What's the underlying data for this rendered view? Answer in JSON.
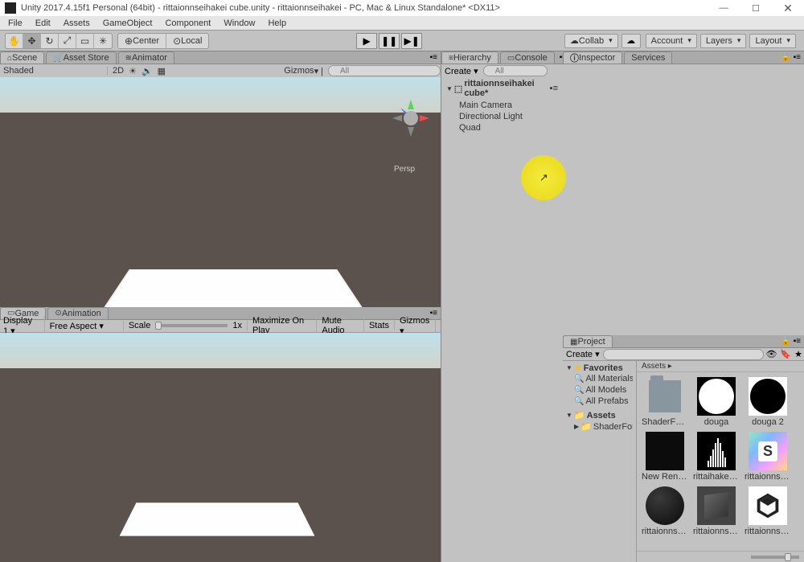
{
  "titlebar": {
    "text": "Unity 2017.4.15f1 Personal (64bit) - rittaionnseihakei cube.unity - rittaionnseihakei - PC, Mac & Linux Standalone* <DX11>",
    "minimize": "—",
    "maximize": "☐",
    "close": "✕"
  },
  "menubar": {
    "items": [
      "File",
      "Edit",
      "Assets",
      "GameObject",
      "Component",
      "Window",
      "Help"
    ]
  },
  "toolbar": {
    "center": "Center",
    "local": "Local",
    "collab": "Collab",
    "account": "Account",
    "layers": "Layers",
    "layout": "Layout"
  },
  "scene_tabs": {
    "scene": "Scene",
    "asset_store": "Asset Store",
    "animator": "Animator"
  },
  "scene_toolbar": {
    "shaded": "Shaded",
    "mode2d": "2D",
    "gizmos": "Gizmos",
    "search_placeholder": "All"
  },
  "scene_overlay": {
    "persp": "Persp"
  },
  "game_tabs": {
    "game": "Game",
    "animation": "Animation"
  },
  "game_toolbar": {
    "display": "Display 1",
    "aspect": "Free Aspect",
    "scale": "Scale",
    "scale_val": "1x",
    "max_play": "Maximize On Play",
    "mute": "Mute Audio",
    "stats": "Stats",
    "gizmos": "Gizmos"
  },
  "hierarchy": {
    "tab": "Hierarchy",
    "console": "Console",
    "create": "Create",
    "search_placeholder": "All",
    "scene": "rittaionnseihakei cube*",
    "items": [
      "Main Camera",
      "Directional Light",
      "Quad"
    ]
  },
  "inspector": {
    "inspector": "Inspector",
    "services": "Services"
  },
  "project": {
    "tab": "Project",
    "create": "Create",
    "favorites": "Favorites",
    "fav_items": [
      "All Materials",
      "All Models",
      "All Prefabs"
    ],
    "assets": "Assets",
    "tree_items": [
      "ShaderForge"
    ],
    "breadcrumb": "Assets ▸",
    "grid": [
      {
        "name": "ShaderForge",
        "type": "folder"
      },
      {
        "name": "douga",
        "type": "white-circle"
      },
      {
        "name": "douga 2",
        "type": "black-circle"
      },
      {
        "name": "New Render...",
        "type": "black"
      },
      {
        "name": "rittaihakei ...",
        "type": "histogram"
      },
      {
        "name": "rittaionnsei...",
        "type": "shader"
      },
      {
        "name": "rittaionnsei...",
        "type": "sphere"
      },
      {
        "name": "rittaionnsei...",
        "type": "cube"
      },
      {
        "name": "rittaionnsei...",
        "type": "unity"
      }
    ]
  }
}
